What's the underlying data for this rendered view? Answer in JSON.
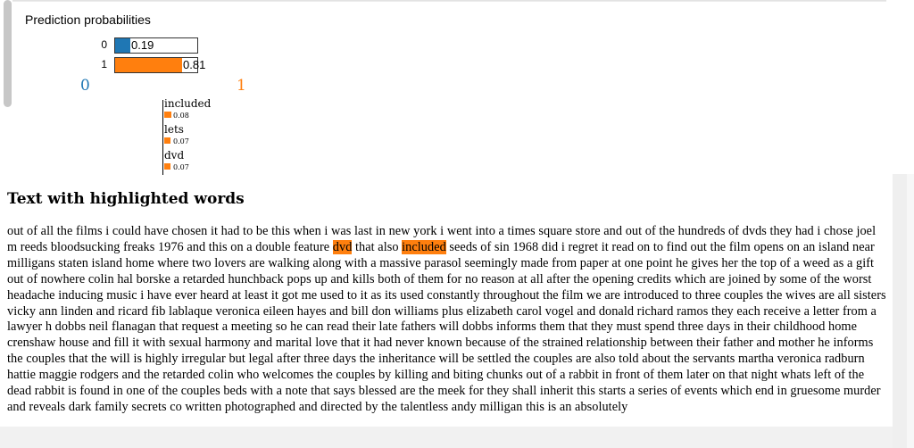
{
  "prediction": {
    "title": "Prediction probabilities",
    "rows": [
      {
        "index": "0",
        "label": "0.19",
        "value": 0.19,
        "color": "#1f77b4"
      },
      {
        "index": "1",
        "label": "0.81",
        "value": 0.81,
        "color": "#ff7f0e"
      }
    ]
  },
  "classes": {
    "left": {
      "label": "0",
      "color": "#1f77b4"
    },
    "right": {
      "label": "1",
      "color": "#ff7f0e"
    }
  },
  "features": [
    {
      "word": "included",
      "weight_label": "0.08",
      "weight": 0.08
    },
    {
      "word": "lets",
      "weight_label": "0.07",
      "weight": 0.07
    },
    {
      "word": "dvd",
      "weight_label": "0.07",
      "weight": 0.07
    }
  ],
  "text_section": {
    "title": "Text with highlighted words",
    "segment_1": "out of all the films i could have chosen it had to be this when i was last in new york i went into a times square store and out of the hundreds of dvds they had i chose joel m reeds bloodsucking freaks 1976 and this on a double feature ",
    "highlight_1": "dvd",
    "segment_2": " that also ",
    "highlight_2": "included",
    "segment_3": " seeds of sin 1968 did i regret it read on to find out the film opens on an island near milligans staten island home where two lovers are walking along with a massive parasol seemingly made from paper at one point he gives her the top of a weed as a gift out of nowhere colin hal borske a retarded hunchback pops up and kills both of them for no reason at all after the opening credits which are joined by some of the worst headache inducing music i have ever heard at least it got me used to it as its used constantly throughout the film we are introduced to three couples the wives are all sisters vicky ann linden and ricard fib lablaque veronica eileen hayes and bill don williams plus elizabeth carol vogel and donald richard ramos they each receive a letter from a lawyer h dobbs neil flanagan that request a meeting so he can read their late fathers will dobbs informs them that they must spend three days in their childhood home crenshaw house and fill it with sexual harmony and marital love that it had never known because of the strained relationship between their father and mother he informs the couples that the will is highly irregular but legal after three days the inheritance will be settled the couples are also told about the servants martha veronica radburn hattie maggie rodgers and the retarded colin who welcomes the couples by killing and biting chunks out of a rabbit in front of them later on that night whats left of the dead rabbit is found in one of the couples beds with a note that says blessed are the meek for they shall inherit this starts a series of events which end in gruesome murder and reveals dark family secrets co written photographed and directed by the talentless andy milligan this is an absolutely"
  },
  "highlight_color": "#ff7f0e"
}
